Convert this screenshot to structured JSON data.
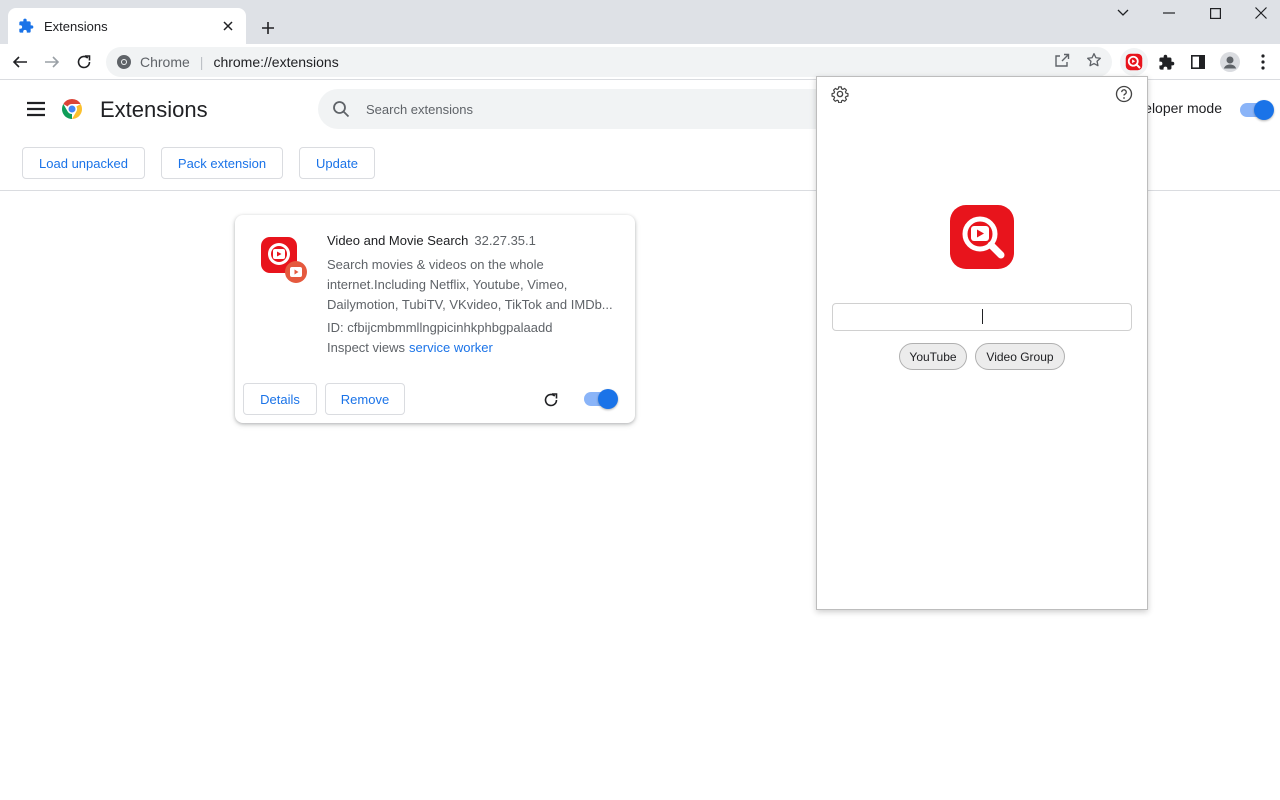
{
  "tab": {
    "title": "Extensions"
  },
  "omnibox": {
    "scheme": "Chrome",
    "url": "chrome://extensions"
  },
  "page": {
    "title": "Extensions",
    "search_placeholder": "Search extensions",
    "dev_mode_label": "Developer mode",
    "dev_mode_on": true
  },
  "actions": {
    "load_unpacked": "Load unpacked",
    "pack_extension": "Pack extension",
    "update": "Update"
  },
  "extension": {
    "name": "Video and Movie Search",
    "version": "32.27.35.1",
    "description": "Search movies & videos on the whole internet.Including Netflix, Youtube, Vimeo, Dailymotion, TubiTV, VKvideo, TikTok and IMDb...",
    "id_text": "ID: cfbijcmbmmllngpicinhkphbgpalaadd",
    "inspect_label": "Inspect views",
    "inspect_link": "service worker",
    "details_label": "Details",
    "remove_label": "Remove",
    "enabled": true
  },
  "popup": {
    "input_value": "",
    "chips": [
      "YouTube",
      "Video Group"
    ]
  },
  "colors": {
    "accent": "#1a73e8",
    "brand_red": "#e8141c",
    "toolbar_bg": "#dee1e6"
  },
  "icons": [
    "puzzle-icon",
    "close-icon",
    "plus-icon",
    "chevron-down-icon",
    "minimize-icon",
    "maximize-icon",
    "window-close-icon",
    "back-icon",
    "forward-icon",
    "reload-icon",
    "chrome-info-icon",
    "share-icon",
    "star-icon",
    "extension-active-icon",
    "extensions-puzzle-icon",
    "side-panel-icon",
    "profile-icon",
    "more-vert-icon",
    "hamburger-icon",
    "chrome-logo-icon",
    "search-icon",
    "gear-icon",
    "help-icon"
  ]
}
